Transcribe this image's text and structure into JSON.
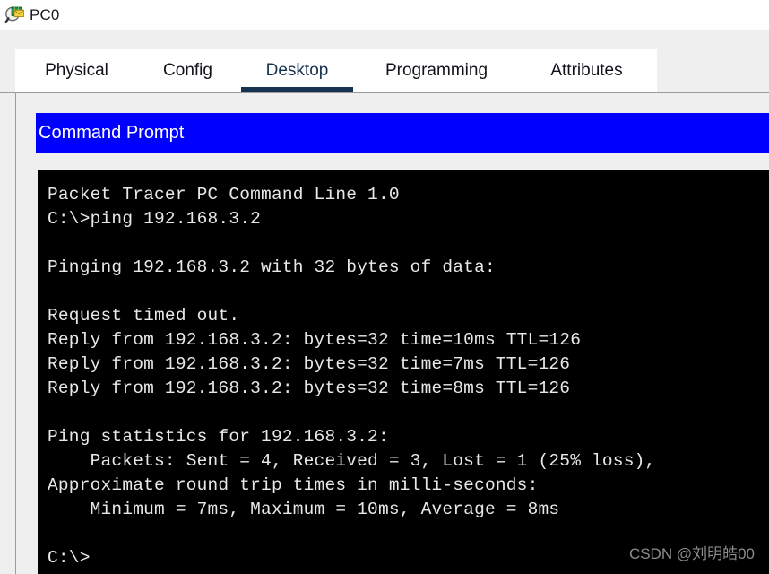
{
  "window": {
    "title": "PC0",
    "icon": "inspect-envelope-icon"
  },
  "tabs": [
    {
      "label": "Physical",
      "active": false
    },
    {
      "label": "Config",
      "active": false
    },
    {
      "label": "Desktop",
      "active": true
    },
    {
      "label": "Programming",
      "active": false
    },
    {
      "label": "Attributes",
      "active": false
    }
  ],
  "application": {
    "header_title": "Command Prompt",
    "header_bg": "#0000ff",
    "header_fg": "#ffffff"
  },
  "terminal": {
    "background": "#000000",
    "foreground": "#e8e8e8",
    "lines": [
      "Packet Tracer PC Command Line 1.0",
      "C:\\>ping 192.168.3.2",
      "",
      "Pinging 192.168.3.2 with 32 bytes of data:",
      "",
      "Request timed out.",
      "Reply from 192.168.3.2: bytes=32 time=10ms TTL=126",
      "Reply from 192.168.3.2: bytes=32 time=7ms TTL=126",
      "Reply from 192.168.3.2: bytes=32 time=8ms TTL=126",
      "",
      "Ping statistics for 192.168.3.2:",
      "    Packets: Sent = 4, Received = 3, Lost = 1 (25% loss),",
      "Approximate round trip times in milli-seconds:",
      "    Minimum = 7ms, Maximum = 10ms, Average = 8ms",
      "",
      "C:\\>"
    ],
    "ping_summary": {
      "target": "192.168.3.2",
      "payload_bytes": 32,
      "sent": 4,
      "received": 3,
      "lost": 1,
      "loss_percent": "25%",
      "minimum_ms": 7,
      "maximum_ms": 10,
      "average_ms": 8,
      "ttl": 126,
      "reply_times_ms": [
        10,
        7,
        8
      ],
      "timeouts": 1
    }
  },
  "watermark": {
    "text": "CSDN @刘明皓00",
    "color": "#8d8d8d"
  }
}
